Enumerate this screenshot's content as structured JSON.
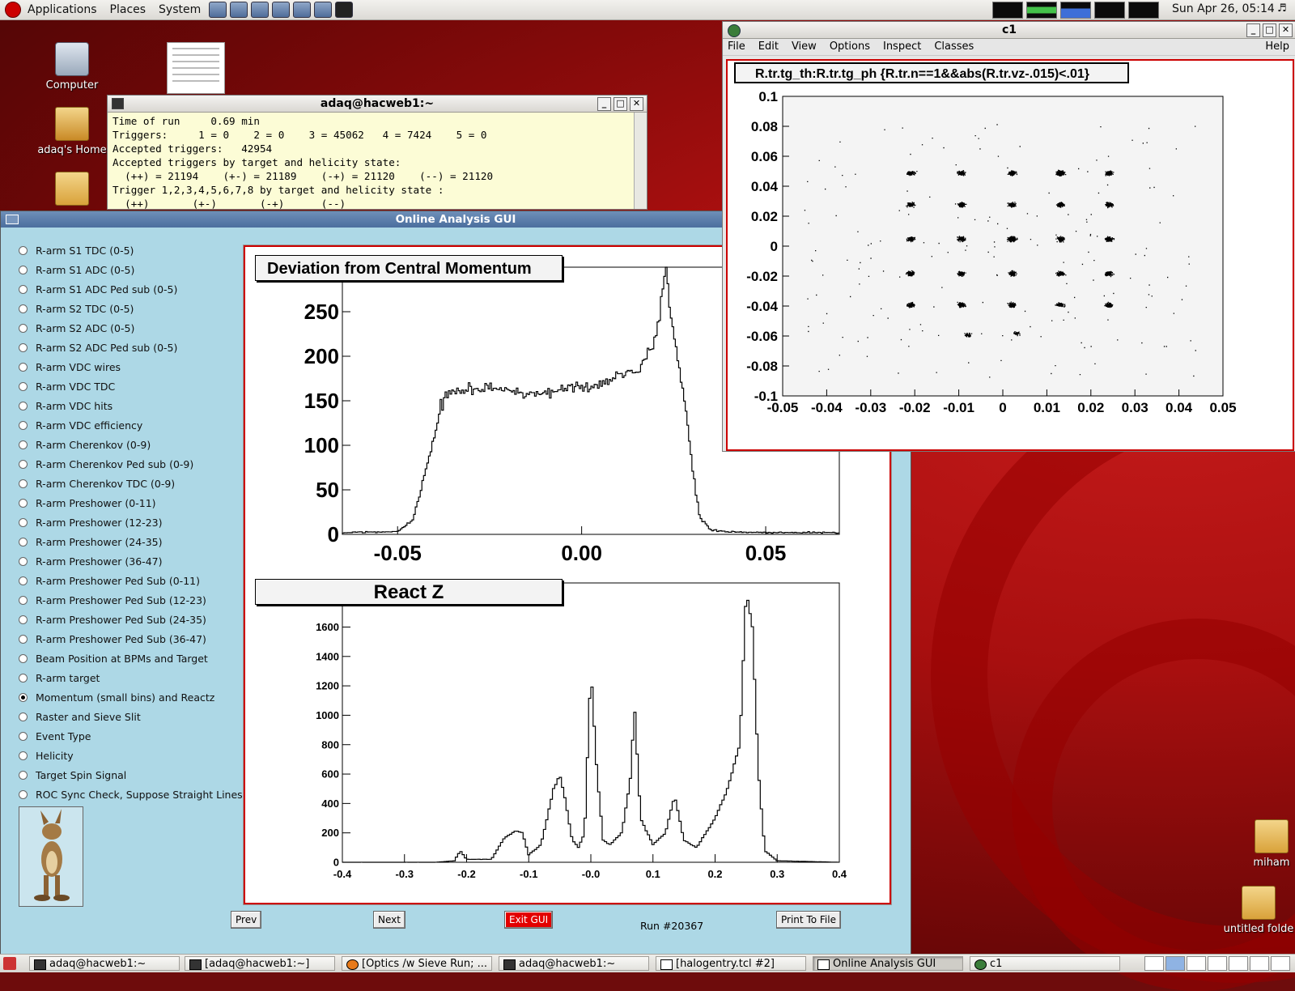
{
  "top_panel": {
    "menus": [
      "Applications",
      "Places",
      "System"
    ],
    "clock": "Sun Apr 26, 05:14"
  },
  "desktop": {
    "icons": [
      "Computer",
      "adaq's Home",
      "miham",
      "untitled folde"
    ]
  },
  "terminal": {
    "title": "adaq@hacweb1:~",
    "lines": [
      "Time of run     0.69 min",
      "Triggers:     1 = 0    2 = 0    3 = 45062   4 = 7424    5 = 0",
      "Accepted triggers:   42954",
      "Accepted triggers by target and helicity state:",
      "  (++) = 21194    (+-) = 21189    (-+) = 21120    (--) = 21120",
      "Trigger 1,2,3,4,5,6,7,8 by target and helicity state :",
      "  (++)       (+-)       (-+)      (--)"
    ]
  },
  "gui": {
    "title": "Online Analysis GUI",
    "options": [
      "R-arm S1 TDC (0-5)",
      "R-arm S1 ADC (0-5)",
      "R-arm S1 ADC Ped sub (0-5)",
      "R-arm S2 TDC (0-5)",
      "R-arm S2 ADC (0-5)",
      "R-arm S2 ADC Ped sub (0-5)",
      "R-arm VDC wires",
      "R-arm VDC TDC",
      "R-arm VDC hits",
      "R-arm VDC efficiency",
      "R-arm Cherenkov (0-9)",
      "R-arm Cherenkov Ped sub (0-9)",
      "R-arm Cherenkov TDC (0-9)",
      "R-arm Preshower (0-11)",
      "R-arm Preshower (12-23)",
      "R-arm Preshower (24-35)",
      "R-arm Preshower (36-47)",
      "R-arm Preshower Ped Sub (0-11)",
      "R-arm Preshower Ped Sub (12-23)",
      "R-arm Preshower Ped Sub (24-35)",
      "R-arm Preshower Ped Sub (36-47)",
      "Beam Position at BPMs and Target",
      "R-arm target",
      "Momentum (small bins) and Reactz",
      "Raster and Sieve Slit",
      "Event Type",
      "Helicity",
      "Target Spin Signal",
      "ROC Sync Check, Suppose Straight Lines"
    ],
    "selected_option": "Momentum (small bins) and Reactz",
    "buttons": {
      "prev": "Prev",
      "next": "Next",
      "exit": "Exit GUI",
      "print": "Print To File"
    },
    "run_label": "Run #20367"
  },
  "c1": {
    "title": "c1",
    "menus": [
      "File",
      "Edit",
      "View",
      "Options",
      "Inspect",
      "Classes"
    ],
    "help": "Help"
  },
  "taskbar": {
    "items": [
      "adaq@hacweb1:~",
      "[adaq@hacweb1:~]",
      "[Optics /w Sieve Run; ...",
      "adaq@hacweb1:~",
      "[halogentry.tcl #2]",
      "Online Analysis GUI",
      "c1"
    ]
  },
  "chart_data": [
    {
      "type": "line",
      "title": "Deviation from Central Momentum",
      "xlim": [
        -0.065,
        0.07
      ],
      "ylim": [
        0,
        300
      ],
      "xticks": [
        "-0.05",
        "0.00",
        "0.05"
      ],
      "yticks": [
        "0",
        "50",
        "100",
        "150",
        "200",
        "250"
      ],
      "x": [
        -0.065,
        -0.05,
        -0.046,
        -0.043,
        -0.04,
        -0.038,
        -0.035,
        -0.03,
        -0.025,
        -0.02,
        -0.015,
        -0.01,
        -0.005,
        0.0,
        0.005,
        0.01,
        0.015,
        0.018,
        0.02,
        0.022,
        0.023,
        0.024,
        0.026,
        0.028,
        0.03,
        0.032,
        0.035,
        0.04,
        0.05,
        0.07
      ],
      "y": [
        2,
        3,
        15,
        60,
        110,
        150,
        160,
        162,
        165,
        160,
        158,
        160,
        162,
        165,
        170,
        180,
        185,
        200,
        220,
        270,
        310,
        250,
        200,
        150,
        80,
        20,
        5,
        3,
        2,
        2
      ]
    },
    {
      "type": "line",
      "title": "React Z",
      "xlim": [
        -0.4,
        0.4
      ],
      "ylim": [
        0,
        1900
      ],
      "xticks": [
        "-0.4",
        "-0.3",
        "-0.2",
        "-0.1",
        "-0.0",
        "0.1",
        "0.2",
        "0.3",
        "0.4"
      ],
      "yticks": [
        "0",
        "200",
        "400",
        "600",
        "800",
        "1000",
        "1200",
        "1400",
        "1600"
      ],
      "x": [
        -0.4,
        -0.25,
        -0.22,
        -0.21,
        -0.2,
        -0.16,
        -0.14,
        -0.12,
        -0.11,
        -0.1,
        -0.08,
        -0.06,
        -0.05,
        -0.04,
        -0.03,
        -0.02,
        -0.01,
        0.0,
        0.01,
        0.02,
        0.03,
        0.05,
        0.065,
        0.07,
        0.08,
        0.1,
        0.12,
        0.135,
        0.15,
        0.17,
        0.2,
        0.22,
        0.24,
        0.25,
        0.26,
        0.27,
        0.28,
        0.3,
        0.4
      ],
      "y": [
        0,
        0,
        10,
        80,
        20,
        20,
        160,
        220,
        200,
        50,
        120,
        500,
        600,
        400,
        150,
        100,
        200,
        1320,
        600,
        150,
        120,
        200,
        600,
        1100,
        300,
        120,
        200,
        450,
        150,
        100,
        300,
        500,
        800,
        1850,
        1600,
        600,
        80,
        10,
        0
      ]
    },
    {
      "type": "scatter",
      "title": "R.tr.tg_th:R.tr.tg_ph {R.tr.n==1&&abs(R.tr.vz-.015)<.01}",
      "xlim": [
        -0.05,
        0.05
      ],
      "ylim": [
        -0.1,
        0.1
      ],
      "xticks": [
        "-0.05",
        "-0.04",
        "-0.03",
        "-0.02",
        "-0.01",
        "0",
        "0.01",
        "0.02",
        "0.03",
        "0.04",
        "0.05"
      ],
      "yticks": [
        "-0.1",
        "-0.08",
        "-0.06",
        "-0.04",
        "-0.02",
        "0",
        "0.02",
        "0.04",
        "0.06",
        "0.08",
        "0.1"
      ],
      "clusters_x": [
        -0.021,
        -0.0095,
        0.002,
        0.013,
        0.024
      ],
      "clusters_y": [
        0.049,
        0.028,
        0.005,
        -0.018,
        -0.039
      ],
      "extra_clusters": [
        [
          -0.008,
          -0.059
        ],
        [
          0.003,
          -0.058
        ]
      ]
    }
  ]
}
